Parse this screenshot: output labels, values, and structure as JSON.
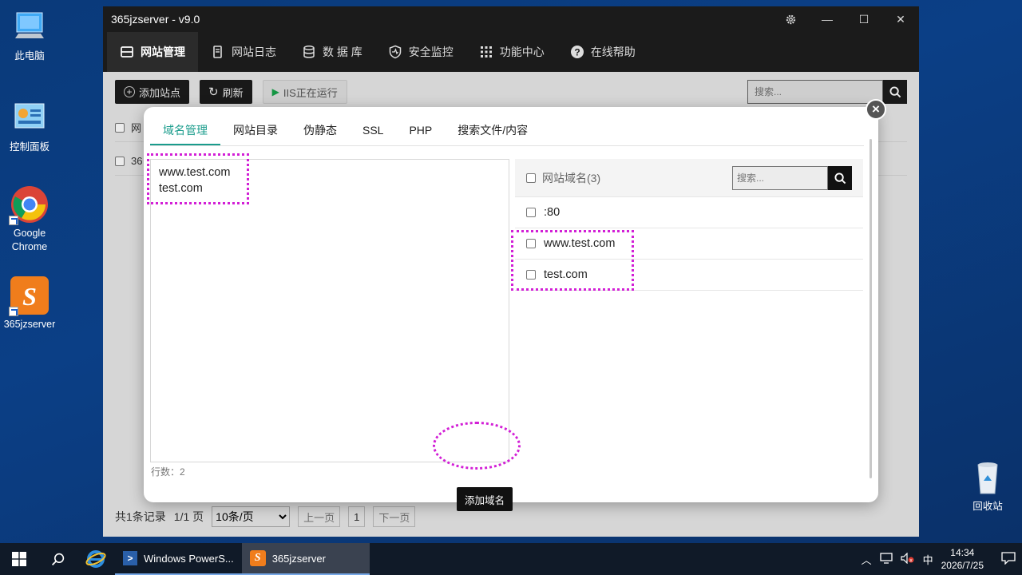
{
  "desktop": {
    "icons": [
      {
        "label": "此电脑",
        "icon": "computer-icon"
      },
      {
        "label": "控制面板",
        "icon": "control-panel-icon"
      },
      {
        "label": "Google Chrome",
        "icon": "chrome-icon"
      },
      {
        "label": "365jzserver",
        "icon": "365jzserver-icon"
      },
      {
        "label": "回收站",
        "icon": "recycle-bin-icon"
      }
    ]
  },
  "app": {
    "title": "365jzserver - v9.0",
    "nav": [
      {
        "label": "网站管理",
        "icon": "website-icon"
      },
      {
        "label": "网站日志",
        "icon": "log-icon"
      },
      {
        "label": "数 据 库",
        "icon": "database-icon"
      },
      {
        "label": "安全监控",
        "icon": "security-icon"
      },
      {
        "label": "功能中心",
        "icon": "grid-icon"
      },
      {
        "label": "在线帮助",
        "icon": "help-icon"
      }
    ],
    "toolbar": {
      "add_site": "添加站点",
      "refresh": "刷新",
      "iis_status": "IIS正在运行",
      "search_placeholder": "搜索..."
    },
    "bg_table": {
      "header_fragment": "网",
      "row_fragment": "36"
    },
    "pager": {
      "total": "共1条记录",
      "pages": "1/1 页",
      "per_page": "10条/页",
      "prev": "上一页",
      "current": "1",
      "next": "下一页"
    }
  },
  "modal": {
    "tabs": [
      "域名管理",
      "网站目录",
      "伪静态",
      "SSL",
      "PHP",
      "搜索文件/内容"
    ],
    "active_tab": "域名管理",
    "textarea_lines": [
      "www.test.com",
      "test.com"
    ],
    "add_button": "添加域名",
    "row_count": "行数：2",
    "domain_list": {
      "header": "网站域名(3)",
      "search_placeholder": "搜索...",
      "rows": [
        ":80",
        "www.test.com",
        "test.com"
      ]
    },
    "accent_color": "#1a9c8c",
    "highlight_color": "#d21fd6"
  },
  "taskbar": {
    "apps": [
      {
        "label": "Windows PowerS...",
        "icon": "powershell-icon"
      },
      {
        "label": "365jzserver",
        "icon": "365jzserver-icon"
      }
    ],
    "ime": "中",
    "time": "14:34",
    "date": "2026/7/25"
  }
}
